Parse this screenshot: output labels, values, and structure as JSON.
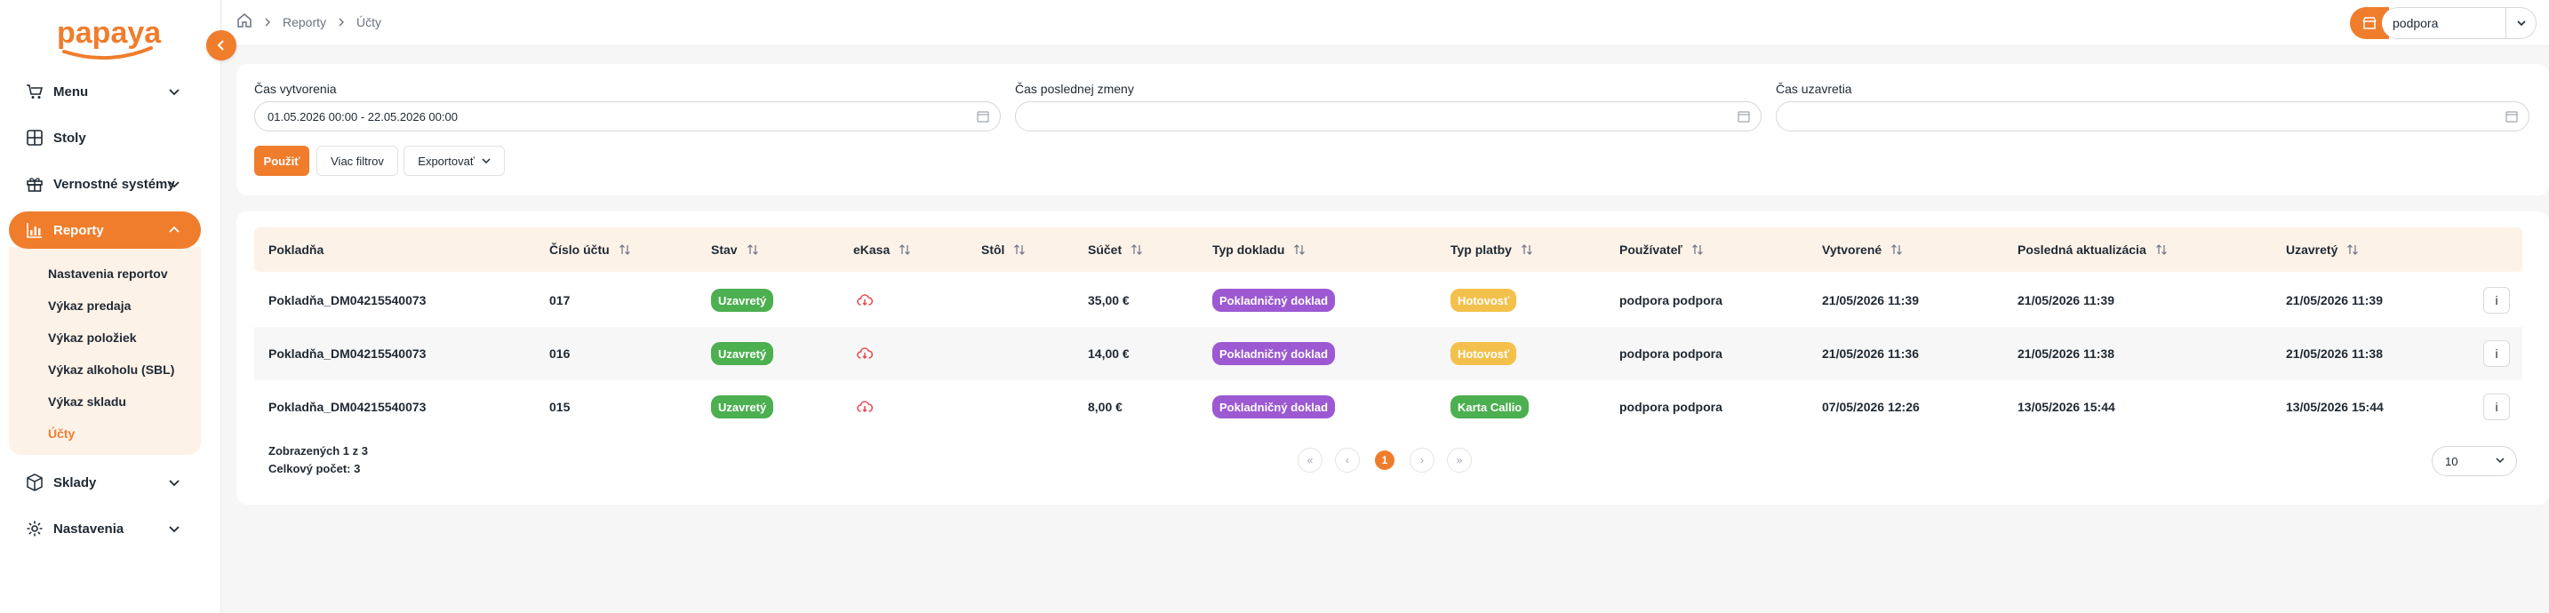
{
  "brand": {
    "logo_text": "papaya",
    "accent": "#f07d2c"
  },
  "sidebar": {
    "items": [
      {
        "label": "Menu",
        "icon": "cart-icon",
        "expandable": true
      },
      {
        "label": "Stoly",
        "icon": "table-icon",
        "expandable": false
      },
      {
        "label": "Vernostné systémy",
        "icon": "gift-icon",
        "expandable": true
      },
      {
        "label": "Reporty",
        "icon": "chart-icon",
        "expandable": true,
        "active": true
      },
      {
        "label": "Sklady",
        "icon": "box-icon",
        "expandable": true
      },
      {
        "label": "Nastavenia",
        "icon": "gear-icon",
        "expandable": true
      }
    ],
    "report_submenu": [
      "Nastavenia reportov",
      "Výkaz predaja",
      "Výkaz položiek",
      "Výkaz alkoholu (SBL)",
      "Výkaz skladu",
      "Účty"
    ]
  },
  "topbar": {
    "breadcrumb": [
      "Reporty",
      "Účty"
    ],
    "user": "podpora"
  },
  "filters": {
    "created_label": "Čas vytvorenia",
    "created_value": "01.05.2026 00:00 - 22.05.2026 00:00",
    "modified_label": "Čas poslednej zmeny",
    "modified_value": "",
    "closed_label": "Čas uzavretia",
    "closed_value": "",
    "apply": "Použiť",
    "more": "Viac filtrov",
    "export": "Exportovať"
  },
  "table": {
    "headers": {
      "register": "Pokladňa",
      "account_no": "Číslo účtu",
      "state": "Stav",
      "ekasa": "eKasa",
      "table": "Stôl",
      "total": "Súčet",
      "doc_type": "Typ dokladu",
      "pay_type": "Typ platby",
      "user": "Používateľ",
      "created": "Vytvorené",
      "updated": "Posledná aktualizácia",
      "closed": "Uzavretý"
    },
    "rows": [
      {
        "register": "Pokladňa_DM04215540073",
        "account_no": "017",
        "state": "Uzavretý",
        "table": "",
        "total": "35,00 €",
        "doc_type": "Pokladničný doklad",
        "pay_type": "Hotovosť",
        "pay_color": "yellow",
        "user": "podpora podpora",
        "created": "21/05/2026 11:39",
        "updated": "21/05/2026 11:39",
        "closed": "21/05/2026 11:39",
        "info": "i"
      },
      {
        "register": "Pokladňa_DM04215540073",
        "account_no": "016",
        "state": "Uzavretý",
        "table": "",
        "total": "14,00 €",
        "doc_type": "Pokladničný doklad",
        "pay_type": "Hotovosť",
        "pay_color": "yellow",
        "user": "podpora podpora",
        "created": "21/05/2026 11:36",
        "updated": "21/05/2026 11:38",
        "closed": "21/05/2026 11:38",
        "info": "i"
      },
      {
        "register": "Pokladňa_DM04215540073",
        "account_no": "015",
        "state": "Uzavretý",
        "table": "",
        "total": "8,00 €",
        "doc_type": "Pokladničný doklad",
        "pay_type": "Karta Callio",
        "pay_color": "green",
        "user": "podpora podpora",
        "created": "07/05/2026 12:26",
        "updated": "13/05/2026 15:44",
        "closed": "13/05/2026 15:44",
        "info": "i"
      }
    ],
    "shown_text": "Zobrazených 1 z 3",
    "total_text": "Celkový počet: 3",
    "pagination": {
      "first": "«",
      "prev": "‹",
      "current": "1",
      "next": "›",
      "last": "»"
    },
    "page_size": "10"
  }
}
